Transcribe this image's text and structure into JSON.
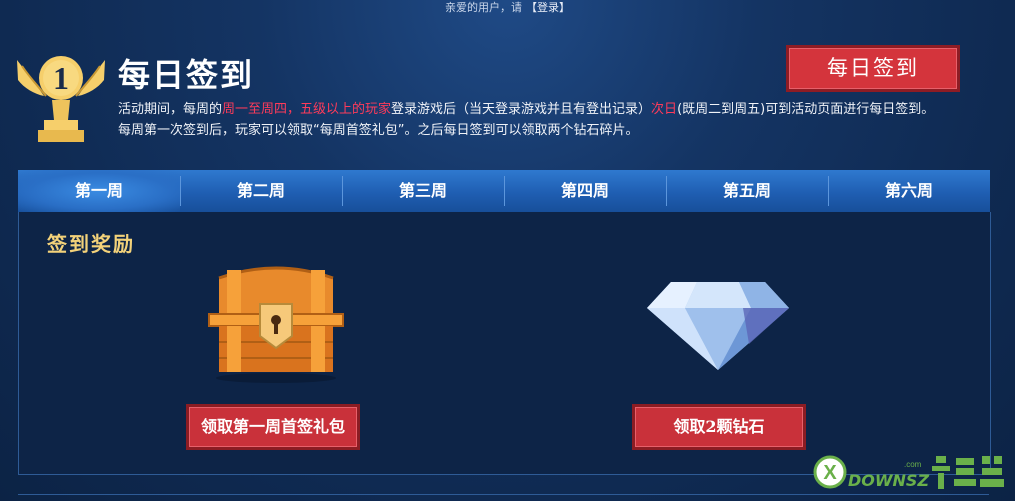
{
  "topbar": {
    "greeting": "亲爱的用户，请",
    "login_label": "【登录】"
  },
  "header": {
    "rank_number": "1",
    "title": "每日签到",
    "signin_button": "每日签到",
    "description": {
      "p1": "活动期间，每周的",
      "h1": "周一至周四，五级以上的玩家",
      "p2": "登录游戏后（当天登录游戏并且有登出记录）",
      "h2": "次日",
      "p3": "(既周二到周五)可到活动页面进行每日签到。 每周第一次签到后，玩家可以领取“每周首签礼包”。之后每日签到可以领取两个钻石碎片。"
    }
  },
  "tabs": [
    "第一周",
    "第二周",
    "第三周",
    "第四周",
    "第五周",
    "第六周"
  ],
  "active_tab_index": 0,
  "rewards": {
    "title": "签到奖励",
    "items": [
      {
        "icon": "treasure-chest-icon",
        "button": "领取第一周首签礼包"
      },
      {
        "icon": "diamond-icon",
        "button": "领取2颗钻石"
      }
    ]
  },
  "watermark": {
    "text": "DOWNSZ",
    "sub": ".com"
  },
  "colors": {
    "accent_red": "#d4343c",
    "highlight": "#ff3b5a",
    "gold": "#f3d27a",
    "tab_blue": "#1f5eb2"
  }
}
